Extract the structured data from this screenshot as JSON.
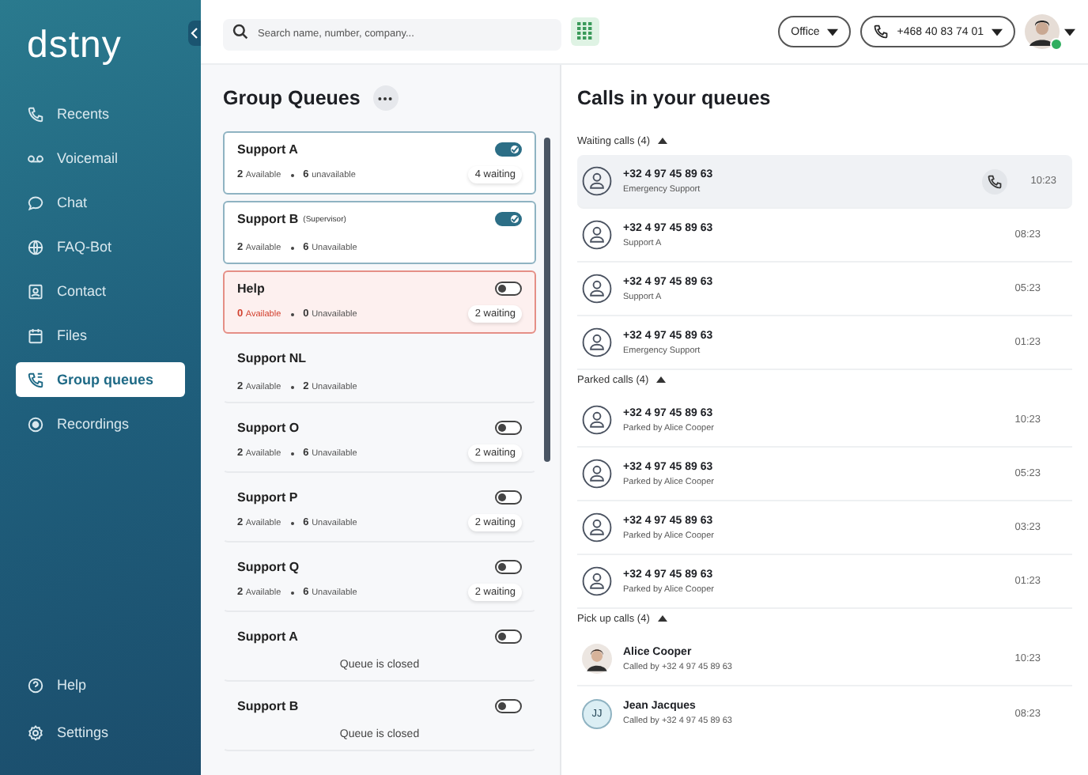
{
  "logo": "dstny",
  "nav": [
    {
      "label": "Recents",
      "selected": false
    },
    {
      "label": "Voicemail",
      "selected": false
    },
    {
      "label": "Chat",
      "selected": false
    },
    {
      "label": "FAQ-Bot",
      "selected": false
    },
    {
      "label": "Contact",
      "selected": false
    },
    {
      "label": "Files",
      "selected": false
    },
    {
      "label": "Group queues",
      "selected": true
    },
    {
      "label": "Recordings",
      "selected": false
    }
  ],
  "nav_bottom": [
    {
      "label": "Help",
      "selected": false
    },
    {
      "label": "Settings",
      "selected": false
    }
  ],
  "search": {
    "placeholder": "Search name, number, company..."
  },
  "location": "Office",
  "phone_number": "+468 40 83 74 01",
  "user_online": true,
  "queues_title": "Group Queues",
  "queues": [
    {
      "name": "Support A",
      "highlighted": true,
      "alert": false,
      "on": true,
      "kind": "stats",
      "available": "2",
      "available_label": "Available",
      "unavailable": "6",
      "unavailable_label": "unavailable",
      "waiting": "4 waiting"
    },
    {
      "name": "Support B",
      "note": "(Supervisor)",
      "highlighted": true,
      "alert": false,
      "on": true,
      "kind": "stats",
      "available": "2",
      "available_label": "Available",
      "unavailable": "6",
      "unavailable_label": "Unavailable"
    },
    {
      "name": "Help",
      "highlighted": false,
      "alert": true,
      "on": false,
      "kind": "stats",
      "available": "0",
      "available_label": "Available",
      "unavailable": "0",
      "unavailable_label": "Unavailable",
      "waiting": "2 waiting"
    },
    {
      "name": "Support NL",
      "highlighted": false,
      "alert": false,
      "kind": "stats",
      "available": "2",
      "available_label": "Available",
      "unavailable": "2",
      "unavailable_label": "Unavailable"
    },
    {
      "name": "Support O",
      "highlighted": false,
      "alert": false,
      "on": false,
      "kind": "stats",
      "available": "2",
      "available_label": "Available",
      "unavailable": "6",
      "unavailable_label": "Unavailable",
      "waiting": "2 waiting"
    },
    {
      "name": "Support P",
      "highlighted": false,
      "alert": false,
      "on": false,
      "kind": "stats",
      "available": "2",
      "available_label": "Available",
      "unavailable": "6",
      "unavailable_label": "Unavailable",
      "waiting": "2 waiting"
    },
    {
      "name": "Support Q",
      "highlighted": false,
      "alert": false,
      "on": false,
      "kind": "stats",
      "available": "2",
      "available_label": "Available",
      "unavailable": "6",
      "unavailable_label": "Unavailable",
      "waiting": "2 waiting"
    },
    {
      "name": "Support A",
      "highlighted": false,
      "alert": false,
      "on": false,
      "kind": "closed",
      "message": "Queue is closed"
    },
    {
      "name": "Support B",
      "highlighted": false,
      "alert": false,
      "on": false,
      "kind": "closed",
      "message": "Queue is closed"
    }
  ],
  "calls_title": "Calls in your queues",
  "sections": [
    {
      "title": "Waiting calls (4)",
      "expanded": true,
      "calls": [
        {
          "kind": "person",
          "title": "+32 4 97 45 89 63",
          "subtitle": "Emergency Support",
          "time": "10:23",
          "selected": true
        },
        {
          "kind": "person",
          "title": "+32 4 97 45 89 63",
          "subtitle": "Support A",
          "time": "08:23",
          "selected": false
        },
        {
          "kind": "person",
          "title": "+32 4 97 45 89 63",
          "subtitle": "Support A",
          "time": "05:23",
          "selected": false
        },
        {
          "kind": "person",
          "title": "+32 4 97 45 89 63",
          "subtitle": "Emergency Support",
          "time": "01:23",
          "selected": false
        }
      ]
    },
    {
      "title": "Parked calls (4)",
      "expanded": true,
      "calls": [
        {
          "kind": "person",
          "title": "+32 4 97 45 89 63",
          "subtitle": "Parked by Alice Cooper",
          "time": "10:23",
          "selected": false
        },
        {
          "kind": "person",
          "title": "+32 4 97 45 89 63",
          "subtitle": "Parked by Alice Cooper",
          "time": "05:23",
          "selected": false
        },
        {
          "kind": "person",
          "title": "+32 4 97 45 89 63",
          "subtitle": "Parked by Alice Cooper",
          "time": "03:23",
          "selected": false
        },
        {
          "kind": "person",
          "title": "+32 4 97 45 89 63",
          "subtitle": "Parked by Alice Cooper",
          "time": "01:23",
          "selected": false
        }
      ]
    },
    {
      "title": "Pick up calls (4)",
      "expanded": true,
      "calls": [
        {
          "title": "Alice Cooper",
          "subtitle": "Called by +32 4 97 45 89 63",
          "time": "10:23",
          "selected": false
        },
        {
          "kind": "initials",
          "initials": "JJ",
          "title": "Jean Jacques",
          "subtitle": "Called by +32 4 97 45 89 63",
          "time": "08:23",
          "selected": false
        }
      ]
    }
  ]
}
